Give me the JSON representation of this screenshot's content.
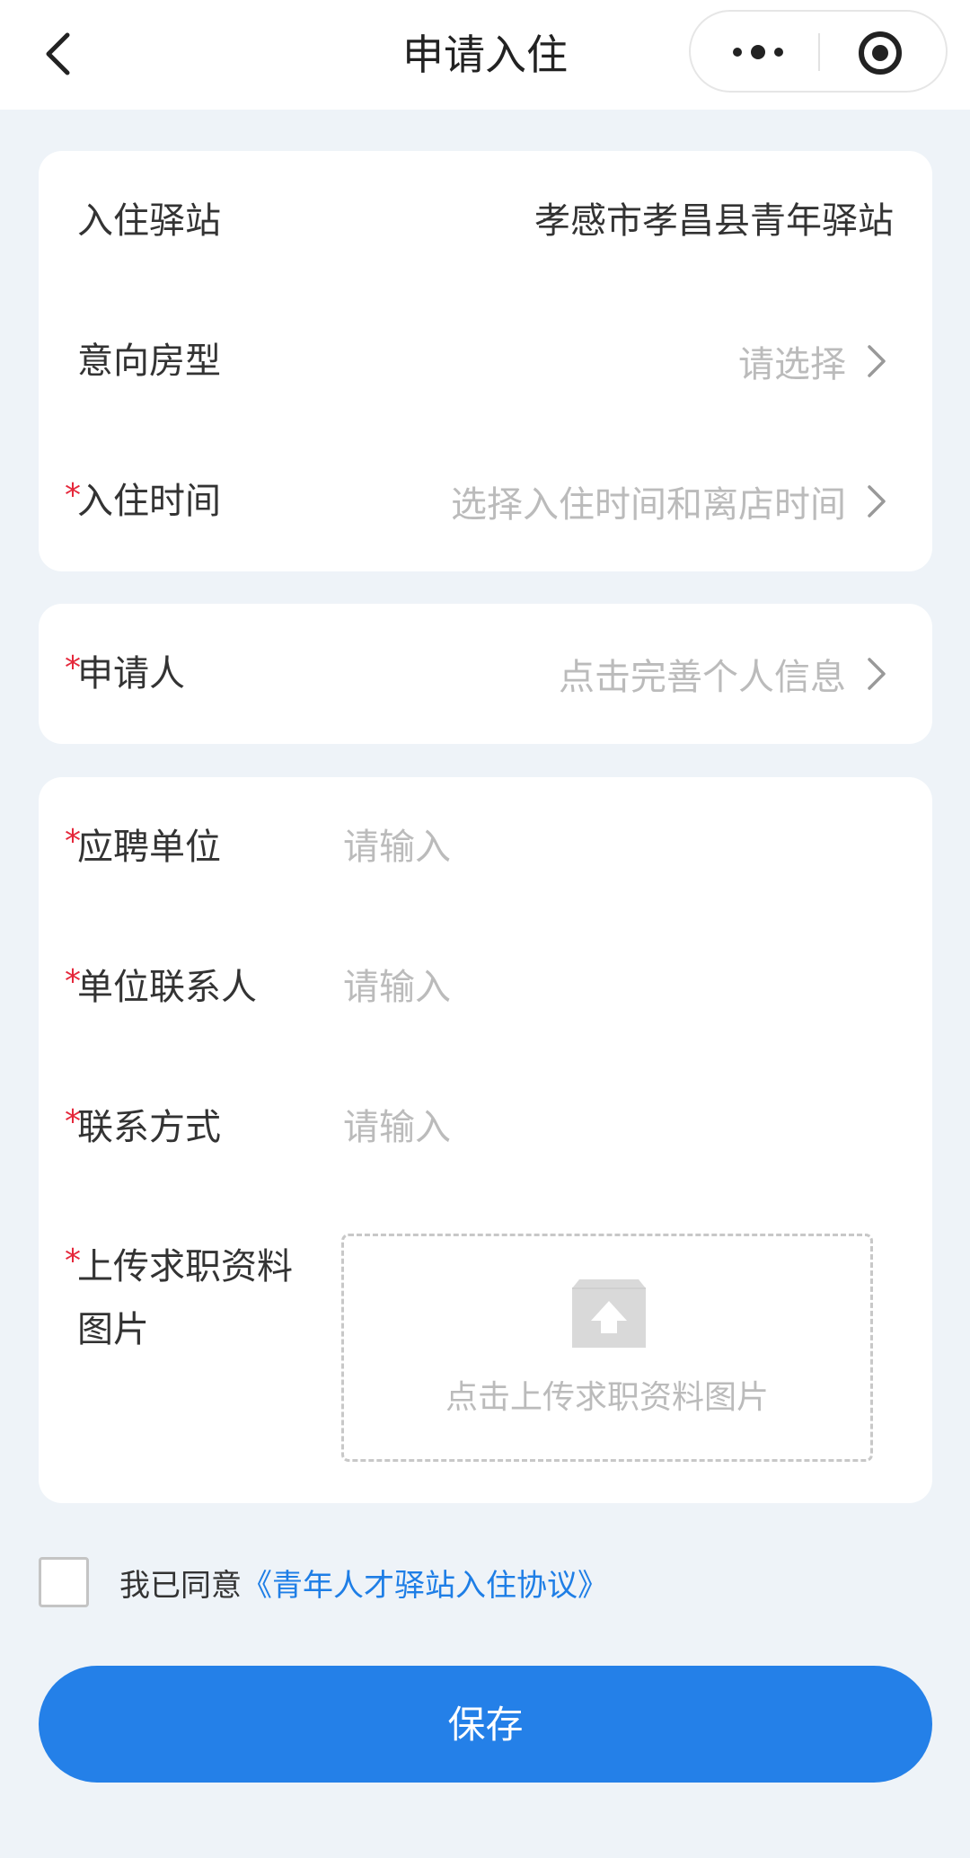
{
  "navbar": {
    "title": "申请入住",
    "back_icon": "chevron-left-icon",
    "more_icon": "more-dots-icon",
    "close_icon": "target-circle-icon"
  },
  "station_card": {
    "station_label": "入住驿站",
    "station_value": "孝感市孝昌县青年驿站",
    "room_type_label": "意向房型",
    "room_type_placeholder": "请选择",
    "checkin_label": "入住时间",
    "checkin_placeholder": "选择入住时间和离店时间"
  },
  "applicant_card": {
    "applicant_label": "申请人",
    "applicant_placeholder": "点击完善个人信息"
  },
  "job_card": {
    "employer_label": "应聘单位",
    "employer_placeholder": "请输入",
    "employer_value": "",
    "contact_label": "单位联系人",
    "contact_placeholder": "请输入",
    "contact_value": "",
    "phone_label": "联系方式",
    "phone_placeholder": "请输入",
    "phone_value": "",
    "upload_label": "上传求职资料图片",
    "upload_hint": "点击上传求职资料图片",
    "upload_icon": "upload-image-icon"
  },
  "required_mark": "*",
  "agreement": {
    "checked": false,
    "prefix": "我已同意",
    "link_text": "《青年人才驿站入住协议》"
  },
  "save_button": {
    "label": "保存"
  },
  "colors": {
    "background": "#eef3f8",
    "accent": "#2480e8",
    "link": "#1e7ee6",
    "required": "#e5283b",
    "placeholder": "#bbbbbb"
  }
}
